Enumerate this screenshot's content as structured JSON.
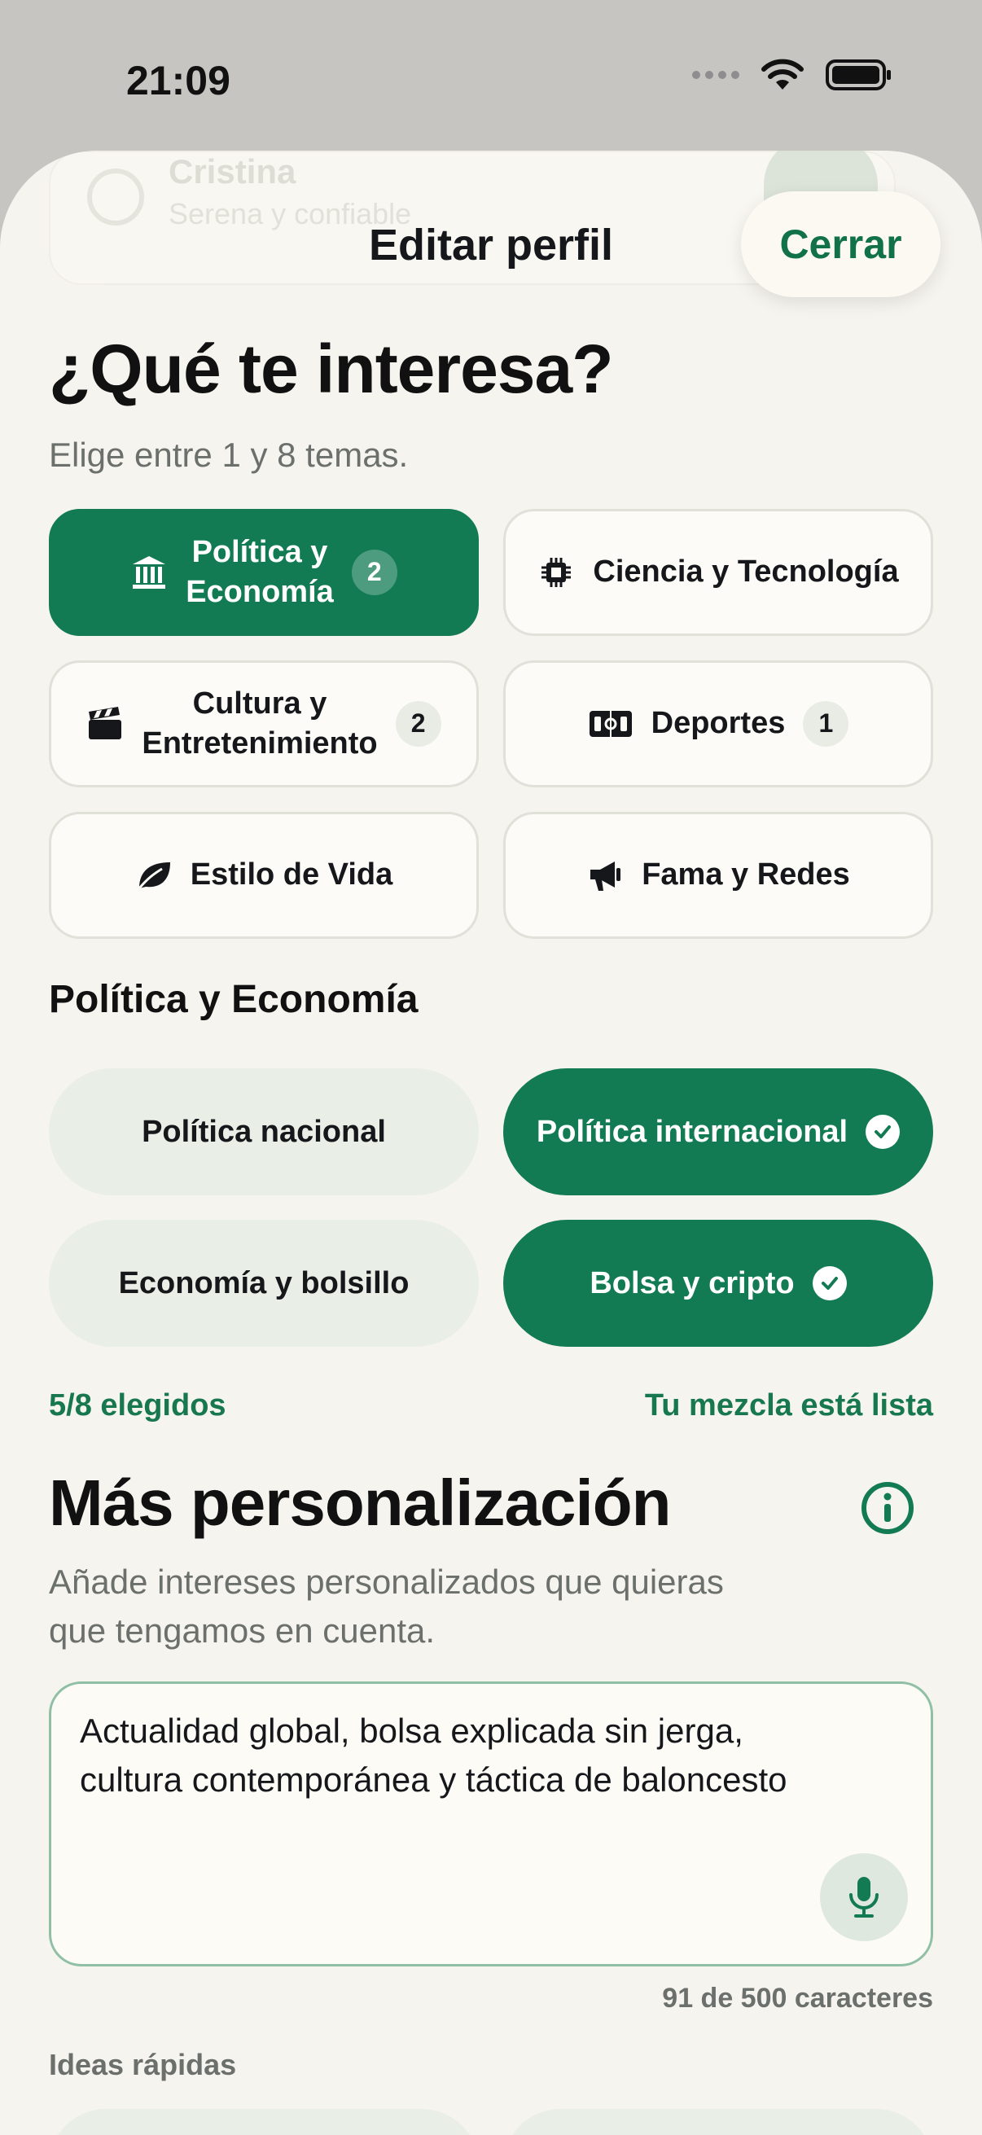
{
  "status": {
    "time": "21:09"
  },
  "background_card": {
    "name": "Cristina",
    "subtitle": "Serena y confiable"
  },
  "nav": {
    "title": "Editar perfil",
    "close_label": "Cerrar"
  },
  "interests": {
    "heading": "¿Qué te interesa?",
    "subtitle": "Elige entre 1 y 8 temas.",
    "topics": [
      {
        "label": "Política y Economía",
        "line1": "Política y",
        "line2": "Economía",
        "icon": "bank-icon",
        "badge": "2",
        "selected": true
      },
      {
        "label": "Ciencia y Tecnología",
        "icon": "chip-icon",
        "badge": null,
        "selected": false
      },
      {
        "label": "Cultura y Entretenimiento",
        "line1": "Cultura y",
        "line2": "Entretenimiento",
        "icon": "clapperboard-icon",
        "badge": "2",
        "selected": false
      },
      {
        "label": "Deportes",
        "icon": "scoreboard-icon",
        "badge": "1",
        "selected": false
      },
      {
        "label": "Estilo de Vida",
        "icon": "leaf-icon",
        "badge": null,
        "selected": false
      },
      {
        "label": "Fama y Redes",
        "icon": "megaphone-icon",
        "badge": null,
        "selected": false
      }
    ]
  },
  "subtopics": {
    "heading": "Política y Economía",
    "items": [
      {
        "label": "Política nacional",
        "selected": false
      },
      {
        "label": "Política internacional",
        "selected": true
      },
      {
        "label": "Economía y bolsillo",
        "selected": false
      },
      {
        "label": "Bolsa y cripto",
        "selected": true
      }
    ],
    "count": "5/8 elegidos",
    "ready": "Tu mezcla está lista"
  },
  "personalization": {
    "heading": "Más personalización",
    "subtitle": "Añade intereses personalizados que quieras que tengamos en cuenta.",
    "text": "Actualidad global, bolsa explicada sin jerga, cultura contemporánea y táctica de baloncesto",
    "char_count": "91 de 500 caracteres",
    "ideas_label": "Ideas rápidas"
  },
  "colors": {
    "accent": "#127b54",
    "background": "#f6f4ee",
    "chip": "#e9eee6"
  }
}
